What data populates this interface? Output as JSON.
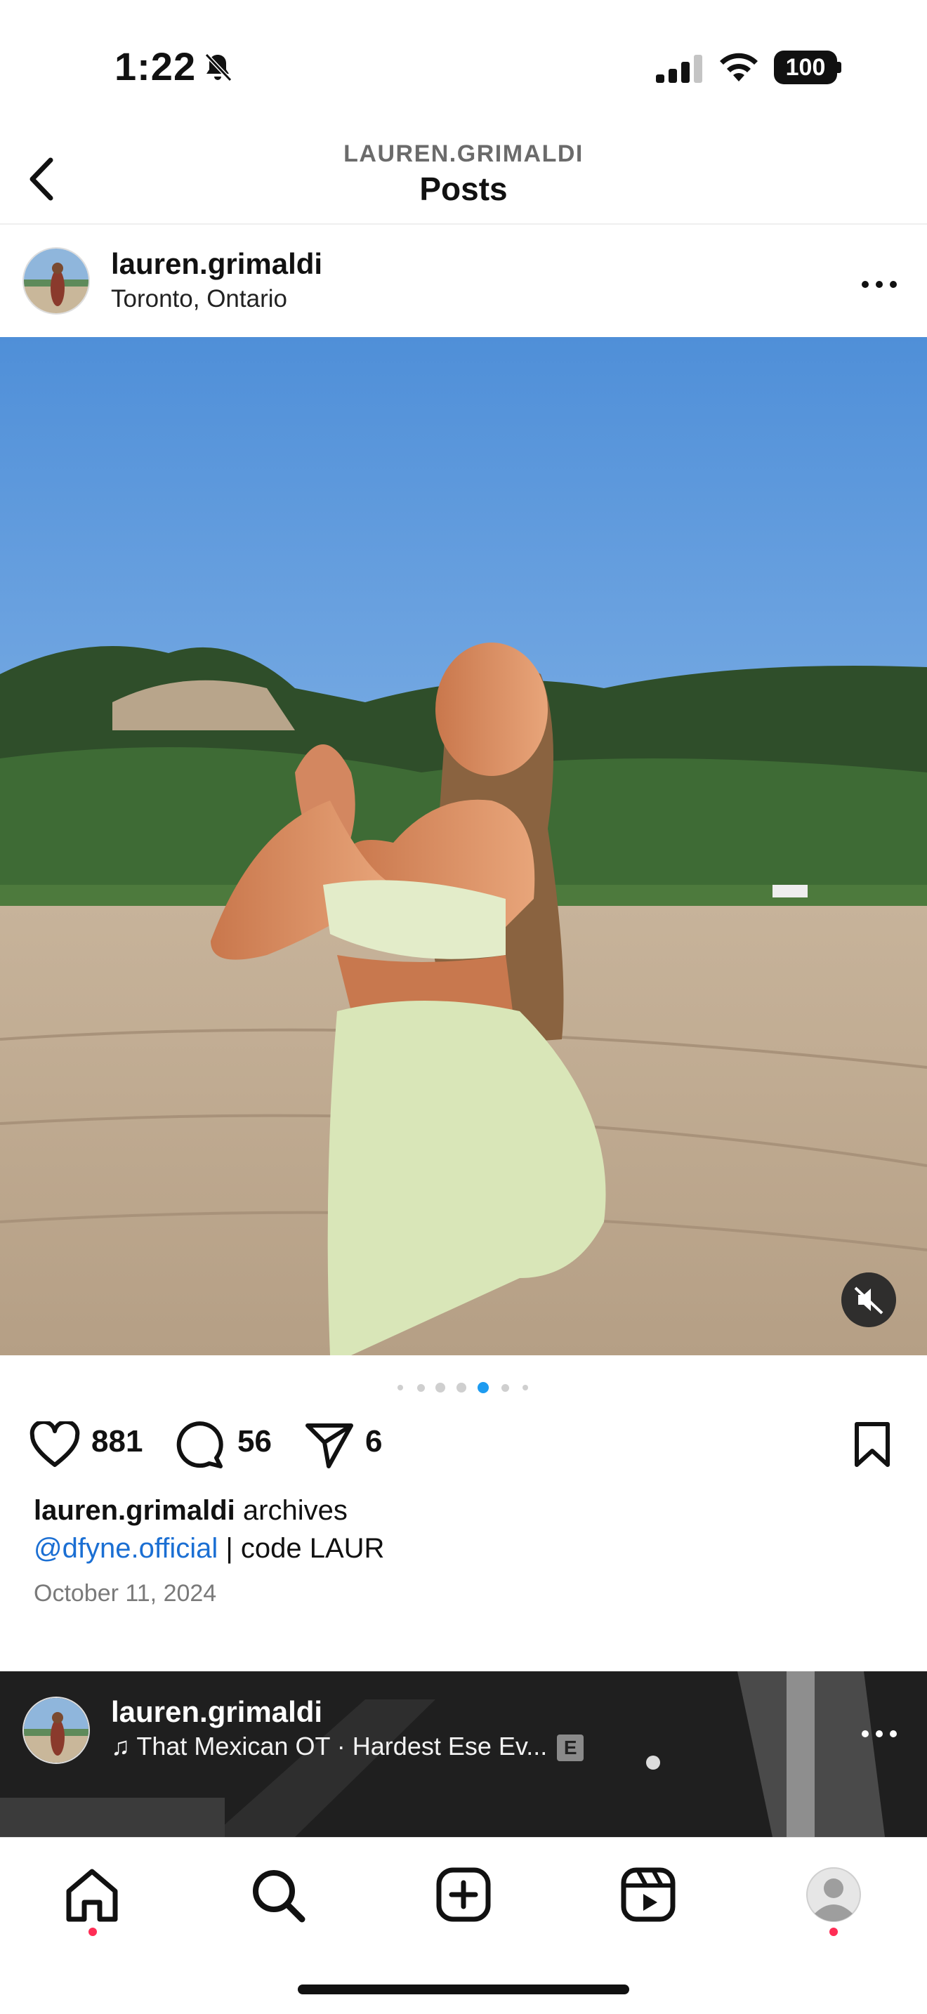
{
  "status_bar": {
    "time": "1:22",
    "battery": "100"
  },
  "header": {
    "subtitle": "LAUREN.GRIMALDI",
    "title": "Posts"
  },
  "post": {
    "username": "lauren.grimaldi",
    "location": "Toronto, Ontario",
    "likes": "881",
    "comments": "56",
    "shares": "6",
    "carousel": {
      "count": 7,
      "active_index": 4
    },
    "caption": {
      "username": "lauren.grimaldi",
      "text": "archives",
      "mention": "@dfyne.official",
      "rest": "| code LAUR"
    },
    "date": "October 11, 2024"
  },
  "next_post": {
    "username": "lauren.grimaldi",
    "music": "That Mexican OT · Hardest Ese Ev...",
    "explicit": "E"
  },
  "tab_bar": {
    "items": [
      "home-icon",
      "search-icon",
      "create-icon",
      "reels-icon",
      "profile-icon"
    ]
  },
  "colors": {
    "mention": "#1b6fd3",
    "notification_dot": "#ff2d55",
    "carousel_active": "#1d9bf0"
  }
}
